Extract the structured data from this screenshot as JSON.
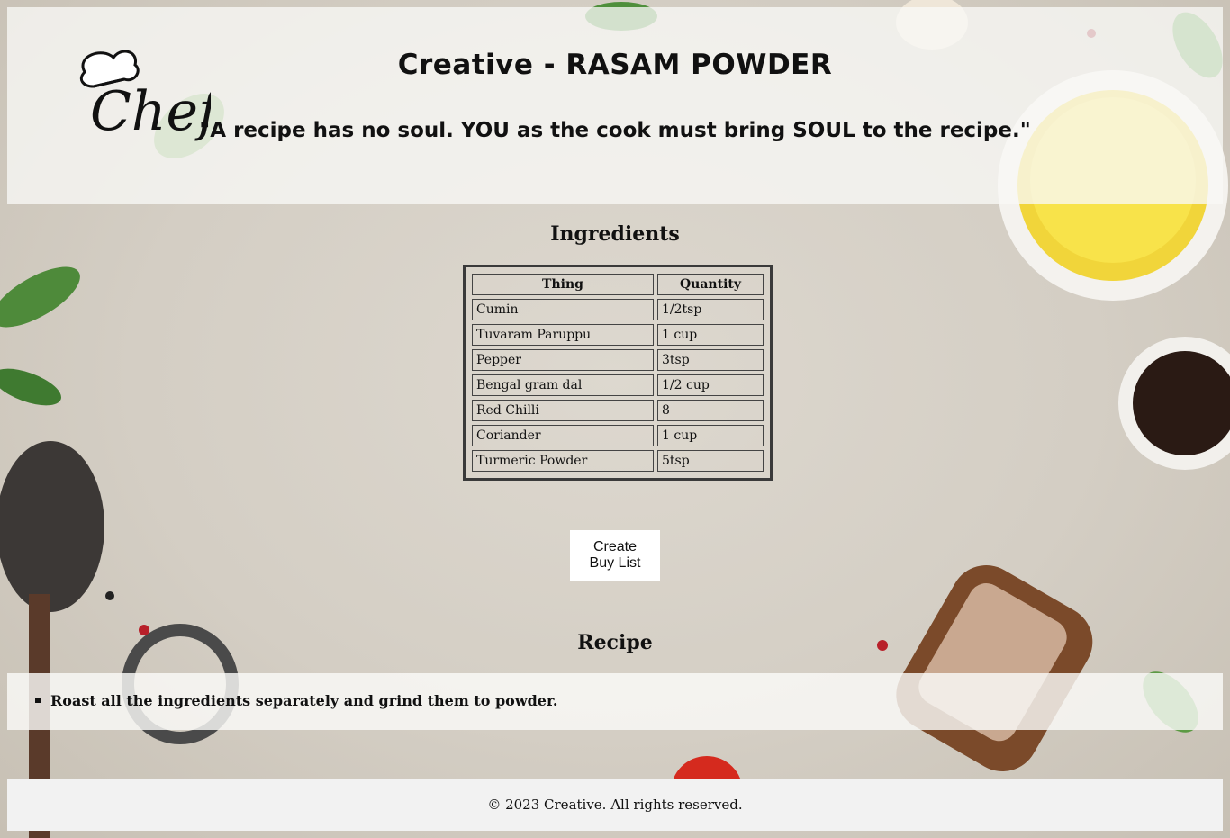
{
  "header": {
    "title": "Creative - RASAM POWDER",
    "quote": "\"A recipe has no soul. YOU as the cook must bring SOUL to the recipe.\""
  },
  "ingredients": {
    "heading": "Ingredients",
    "columns": [
      "Thing",
      "Quantity"
    ],
    "rows": [
      [
        "Cumin",
        "1/2tsp"
      ],
      [
        "Tuvaram Paruppu",
        "1 cup"
      ],
      [
        "Pepper",
        "3tsp"
      ],
      [
        "Bengal gram dal",
        "1/2 cup"
      ],
      [
        "Red Chilli",
        "8"
      ],
      [
        "Coriander",
        "1 cup"
      ],
      [
        "Turmeric Powder",
        "5tsp"
      ]
    ]
  },
  "buy_list_button": {
    "label_line1": "Create",
    "label_line2": "Buy List"
  },
  "recipe": {
    "heading": "Recipe",
    "steps": [
      "Roast all the ingredients separately and grind them to powder."
    ]
  },
  "footer": {
    "text": "© 2023 Creative. All rights reserved."
  },
  "colors": {
    "header_bg": "#f8f8f6",
    "footer_bg": "#f2f2f2",
    "button_bg": "#ffffff",
    "text": "#111111"
  }
}
